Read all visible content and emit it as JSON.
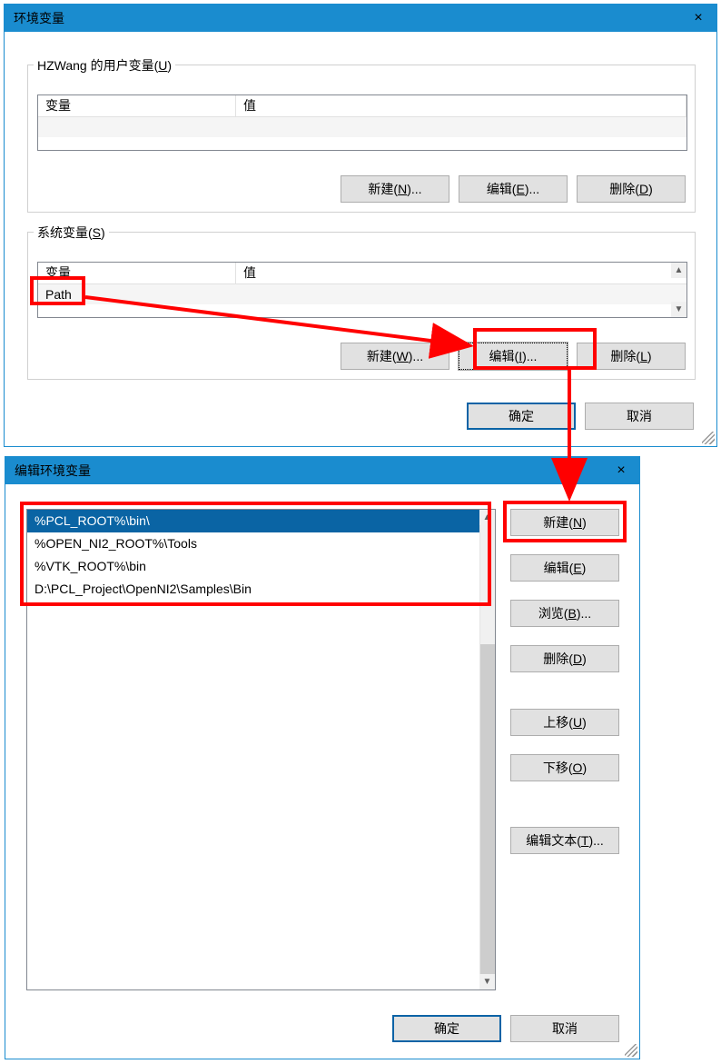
{
  "window1": {
    "title": "环境变量",
    "user_group_label_prefix": "HZWang 的用户变量(",
    "user_group_label_hot": "U",
    "user_group_label_suffix": ")",
    "col_var": "变量",
    "col_val": "值",
    "sys_group_label_prefix": "系统变量(",
    "sys_group_label_hot": "S",
    "sys_group_label_suffix": ")",
    "sys_row_var": "Path",
    "btn_new_user": "新建(N)...",
    "btn_edit_user": "编辑(E)...",
    "btn_delete_user": "删除(D)",
    "btn_new_sys": "新建(W)...",
    "btn_edit_sys": "编辑(I)...",
    "btn_delete_sys": "删除(L)",
    "btn_ok": "确定",
    "btn_cancel": "取消"
  },
  "window2": {
    "title": "编辑环境变量",
    "items": {
      "i0": "%PCL_ROOT%\\bin\\",
      "i1": "%OPEN_NI2_ROOT%\\Tools",
      "i2": "%VTK_ROOT%\\bin",
      "i3": "D:\\PCL_Project\\OpenNI2\\Samples\\Bin"
    },
    "btn_new": "新建(N)",
    "btn_edit": "编辑(E)",
    "btn_browse": "浏览(B)...",
    "btn_delete": "删除(D)",
    "btn_up": "上移(U)",
    "btn_down": "下移(O)",
    "btn_edittext": "编辑文本(T)...",
    "btn_ok": "确定",
    "btn_cancel": "取消"
  }
}
